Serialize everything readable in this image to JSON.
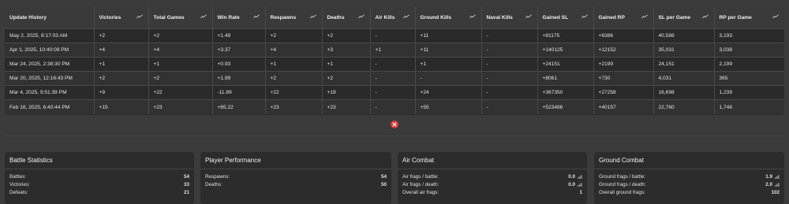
{
  "table": {
    "headers": [
      {
        "label": "Update History",
        "trend": false
      },
      {
        "label": "Victories",
        "trend": true
      },
      {
        "label": "Total Games",
        "trend": true
      },
      {
        "label": "Win Rate",
        "trend": true
      },
      {
        "label": "Respawns",
        "trend": true
      },
      {
        "label": "Deaths",
        "trend": true
      },
      {
        "label": "Air Kills",
        "trend": true
      },
      {
        "label": "Ground Kills",
        "trend": true
      },
      {
        "label": "Naval Kills",
        "trend": true
      },
      {
        "label": "Gained SL",
        "trend": true
      },
      {
        "label": "Gained RP",
        "trend": true
      },
      {
        "label": "SL per Game",
        "trend": true
      },
      {
        "label": "RP per Game",
        "trend": true
      }
    ],
    "rows": [
      [
        "May 2, 2025, 8:17:03 AM",
        "+2",
        "+2",
        "+1.49",
        "+2",
        "+2",
        "-",
        "+11",
        "-",
        "+81175",
        "+6386",
        "40,588",
        "3,193"
      ],
      [
        "Apr 1, 2025, 10:40:09 PM",
        "+4",
        "+4",
        "+3.37",
        "+4",
        "+3",
        "+1",
        "+11",
        "-",
        "+140125",
        "+12152",
        "35,031",
        "3,038"
      ],
      [
        "Mar 24, 2025, 2:38:30 PM",
        "+1",
        "+1",
        "+0.93",
        "+1",
        "+1",
        "-",
        "+1",
        "-",
        "+24151",
        "+2199",
        "24,151",
        "2,199"
      ],
      [
        "Mar 20, 2025, 12:16:43 PM",
        "+2",
        "+2",
        "+1.99",
        "+2",
        "+2",
        "-",
        "-",
        "-",
        "+8061",
        "+730",
        "4,031",
        "365"
      ],
      [
        "Mar 4, 2025, 9:51:39 PM",
        "+9",
        "+22",
        "-11.89",
        "+22",
        "+19",
        "-",
        "+24",
        "-",
        "+367350",
        "+27258",
        "16,698",
        "1,239"
      ],
      [
        "Feb 16, 2025, 6:40:44 PM",
        "+15",
        "+23",
        "+65.22",
        "+23",
        "+23",
        "-",
        "+55",
        "-",
        "+523486",
        "+40157",
        "22,760",
        "1,746"
      ]
    ]
  },
  "panels": {
    "battle": {
      "title": "Battle Statistics",
      "rows": [
        {
          "label": "Battles:",
          "value": "54"
        },
        {
          "label": "Victories:",
          "value": "33"
        },
        {
          "label": "Defeats:",
          "value": "21"
        }
      ]
    },
    "player": {
      "title": "Player Performance",
      "rows": [
        {
          "label": "Respawns:",
          "value": "54"
        },
        {
          "label": "Deaths:",
          "value": "50"
        }
      ]
    },
    "air": {
      "title": "Air Combat",
      "rows": [
        {
          "label": "Air frags / battle:",
          "value": "0.0",
          "icon": true
        },
        {
          "label": "Air frags / death:",
          "value": "0.0",
          "icon": true
        },
        {
          "label": "Overall air frags:",
          "value": "1",
          "icon": false
        }
      ]
    },
    "ground": {
      "title": "Ground Combat",
      "rows": [
        {
          "label": "Ground frags / battle:",
          "value": "1.9",
          "icon": true
        },
        {
          "label": "Ground frags / death:",
          "value": "2.0",
          "icon": true
        },
        {
          "label": "Overall ground frags:",
          "value": "102",
          "icon": false
        }
      ]
    }
  },
  "colors": {
    "accent_close": "#d93a3a",
    "background": "#3b3b3b",
    "panel": "#2c2c2c"
  },
  "icons": {
    "trend": "trend-chart-icon",
    "close": "close-icon",
    "bar": "bar-chart-icon"
  }
}
